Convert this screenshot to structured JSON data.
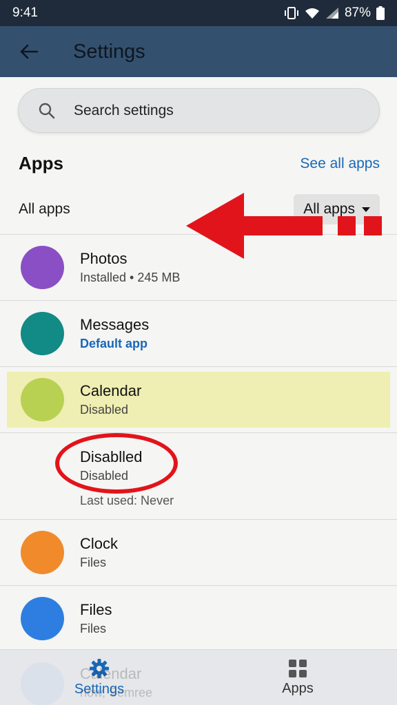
{
  "status": {
    "time": "9:41",
    "battery": "87%"
  },
  "app_bar": {
    "title": "Settings"
  },
  "search": {
    "placeholder": "Search settings"
  },
  "section": {
    "title": "Apps",
    "see_all": "See all apps"
  },
  "filter": {
    "label": "All apps",
    "selected": "All apps"
  },
  "apps": [
    {
      "name": "Photos",
      "sub": "Installed • 245 MB",
      "color": "#8a4fc4"
    },
    {
      "name": "Messages",
      "sub": "Default app",
      "color": "#128a86"
    },
    {
      "name": "Calendar",
      "sub": "Disabled",
      "color": "#b8d152"
    },
    {
      "name": "Clock",
      "sub": "Files",
      "color": "#f08a2b"
    },
    {
      "name": "Files",
      "sub": "Files",
      "color": "#2d7ee0"
    }
  ],
  "expanded": {
    "title": "Disablled",
    "sub": "Disabled",
    "meta": "Last used: Never"
  },
  "ghost_row": {
    "title": "Calendar",
    "sub": "now, Semree"
  },
  "bottom_nav": {
    "settings": "Settings",
    "apps": "Apps"
  },
  "colors": {
    "accent": "#1767b8",
    "annotation": "#e2141b",
    "highlight": "#efeeb3",
    "app_bar": "#33506f"
  }
}
